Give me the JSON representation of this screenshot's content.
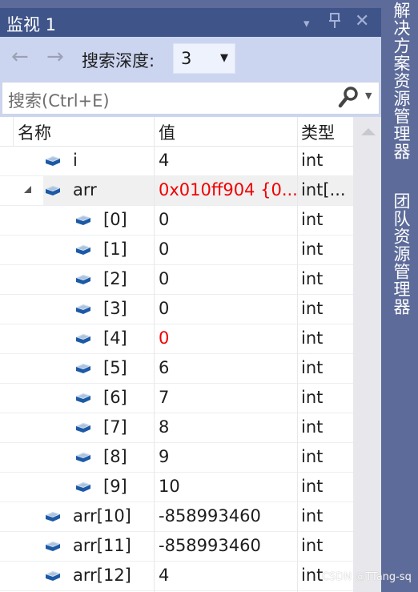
{
  "window": {
    "title": "监视 1",
    "buttons": {
      "dropdown": "▾",
      "pin": "⊥",
      "close": "✕"
    }
  },
  "toolbar": {
    "back_icon": "←",
    "forward_icon": "→",
    "depth_label": "搜索深度:",
    "depth_value": "3",
    "depth_caret": "▼"
  },
  "search": {
    "placeholder": "搜索(Ctrl+E)",
    "icon": "⚲",
    "caret": "▼"
  },
  "grid": {
    "columns": [
      "名称",
      "值",
      "类型"
    ],
    "rows": [
      {
        "name": "i",
        "value": "4",
        "type": "int",
        "level": 0,
        "changed": false
      },
      {
        "name": "arr",
        "value": "0x010ff904 {0...",
        "type": "int[...",
        "level": 0,
        "expanded": true,
        "changed": true
      },
      {
        "name": "[0]",
        "value": "0",
        "type": "int",
        "level": 1,
        "changed": false
      },
      {
        "name": "[1]",
        "value": "0",
        "type": "int",
        "level": 1,
        "changed": false
      },
      {
        "name": "[2]",
        "value": "0",
        "type": "int",
        "level": 1,
        "changed": false
      },
      {
        "name": "[3]",
        "value": "0",
        "type": "int",
        "level": 1,
        "changed": false
      },
      {
        "name": "[4]",
        "value": "0",
        "type": "int",
        "level": 1,
        "changed": true
      },
      {
        "name": "[5]",
        "value": "6",
        "type": "int",
        "level": 1,
        "changed": false
      },
      {
        "name": "[6]",
        "value": "7",
        "type": "int",
        "level": 1,
        "changed": false
      },
      {
        "name": "[7]",
        "value": "8",
        "type": "int",
        "level": 1,
        "changed": false
      },
      {
        "name": "[8]",
        "value": "9",
        "type": "int",
        "level": 1,
        "changed": false
      },
      {
        "name": "[9]",
        "value": "10",
        "type": "int",
        "level": 1,
        "changed": false
      },
      {
        "name": "arr[10]",
        "value": "-858993460",
        "type": "int",
        "level": 0,
        "changed": false
      },
      {
        "name": "arr[11]",
        "value": "-858993460",
        "type": "int",
        "level": 0,
        "changed": false
      },
      {
        "name": "arr[12]",
        "value": "4",
        "type": "int",
        "level": 0,
        "changed": false
      }
    ]
  },
  "side_tabs": [
    "解决方案资源管理器",
    "团队资源管理器"
  ],
  "watermark": "CSDN @TTang-sq",
  "colors": {
    "title_bar": "#3f5489",
    "toolbar": "#ccd5f0",
    "side_strip": "#5c6b99",
    "changed_value": "#f00000",
    "object_icon": "#1c5aa6"
  }
}
